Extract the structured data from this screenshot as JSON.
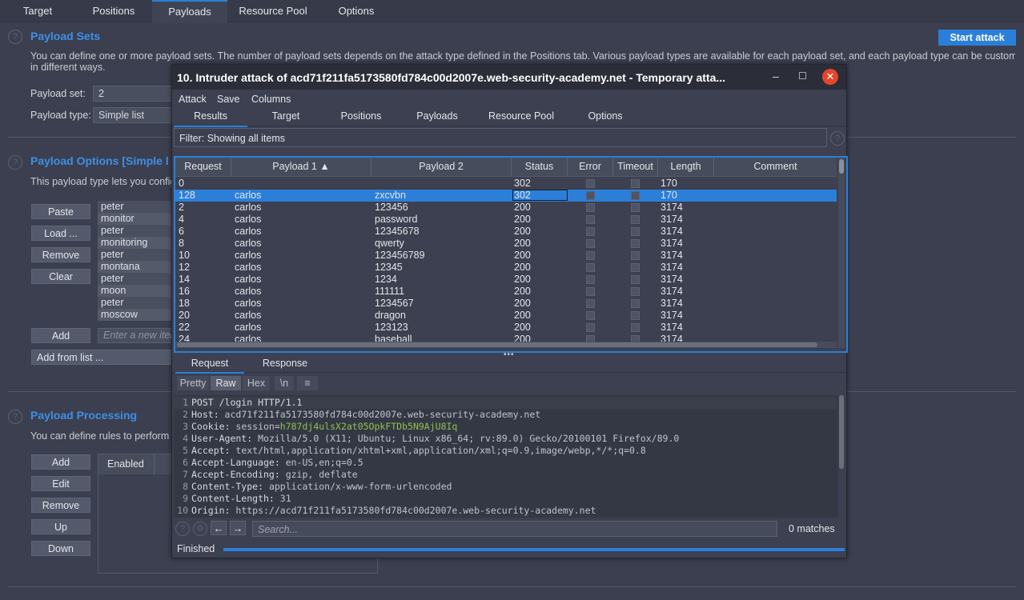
{
  "top_tabs": [
    "Target",
    "Positions",
    "Payloads",
    "Resource Pool",
    "Options"
  ],
  "active_top_tab": "Payloads",
  "start_attack_label": "Start attack",
  "payload_sets": {
    "title": "Payload Sets",
    "description_line1": "You can define one or more payload sets. The number of payload sets depends on the attack type defined in the Positions tab. Various payload types are available for each payload set, and each payload type can be customized",
    "description_line2": "in different ways.",
    "set_label": "Payload set:",
    "set_value": "2",
    "type_label": "Payload type:",
    "type_value": "Simple list"
  },
  "payload_options": {
    "title": "Payload Options [Simple l",
    "description": "This payload type lets you config",
    "buttons": [
      "Paste",
      "Load ...",
      "Remove",
      "Clear"
    ],
    "list_items": [
      "peter",
      "monitor",
      "peter",
      "monitoring",
      "peter",
      "montana",
      "peter",
      "moon",
      "peter",
      "moscow"
    ],
    "add_label": "Add",
    "add_placeholder": "Enter a new iter",
    "add_from_list_label": "Add from list ..."
  },
  "payload_processing": {
    "title": "Payload Processing",
    "description": "You can define rules to perform w",
    "buttons": [
      "Add",
      "Edit",
      "Remove",
      "Up",
      "Down"
    ],
    "table_header": "Enabled"
  },
  "dialog": {
    "title": "10. Intruder attack of acd71f211fa5173580fd784c00d2007e.web-security-academy.net - Temporary atta...",
    "minimize": "–",
    "maximize": "☐",
    "close": "✕",
    "menu": [
      "Attack",
      "Save",
      "Columns"
    ],
    "tabs": [
      "Results",
      "Target",
      "Positions",
      "Payloads",
      "Resource Pool",
      "Options"
    ],
    "active_tab": "Results",
    "filter_text": "Filter: Showing all items",
    "columns": [
      "Request",
      "Payload 1 ▲",
      "Payload 2",
      "Status",
      "Error",
      "Timeout",
      "Length",
      "Comment"
    ],
    "rows": [
      {
        "request": "0",
        "p1": "",
        "p2": "",
        "status": "302",
        "length": "170"
      },
      {
        "request": "128",
        "p1": "carlos",
        "p2": "zxcvbn",
        "status": "302",
        "length": "170"
      },
      {
        "request": "2",
        "p1": "carlos",
        "p2": "123456",
        "status": "200",
        "length": "3174"
      },
      {
        "request": "4",
        "p1": "carlos",
        "p2": "password",
        "status": "200",
        "length": "3174"
      },
      {
        "request": "6",
        "p1": "carlos",
        "p2": "12345678",
        "status": "200",
        "length": "3174"
      },
      {
        "request": "8",
        "p1": "carlos",
        "p2": "qwerty",
        "status": "200",
        "length": "3174"
      },
      {
        "request": "10",
        "p1": "carlos",
        "p2": "123456789",
        "status": "200",
        "length": "3174"
      },
      {
        "request": "12",
        "p1": "carlos",
        "p2": "12345",
        "status": "200",
        "length": "3174"
      },
      {
        "request": "14",
        "p1": "carlos",
        "p2": "1234",
        "status": "200",
        "length": "3174"
      },
      {
        "request": "16",
        "p1": "carlos",
        "p2": "111111",
        "status": "200",
        "length": "3174"
      },
      {
        "request": "18",
        "p1": "carlos",
        "p2": "1234567",
        "status": "200",
        "length": "3174"
      },
      {
        "request": "20",
        "p1": "carlos",
        "p2": "dragon",
        "status": "200",
        "length": "3174"
      },
      {
        "request": "22",
        "p1": "carlos",
        "p2": "123123",
        "status": "200",
        "length": "3174"
      },
      {
        "request": "24",
        "p1": "carlos",
        "p2": "baseball",
        "status": "200",
        "length": "3174"
      }
    ],
    "selected_row_index": 1,
    "req_resp_tabs": [
      "Request",
      "Response"
    ],
    "active_req_resp_tab": "Request",
    "format_buttons": [
      "Pretty",
      "Raw",
      "Hex",
      "\\n",
      "≡"
    ],
    "active_format": "Raw",
    "request_lines": [
      {
        "n": "1",
        "name": "POST /login HTTP/1.1",
        "value": ""
      },
      {
        "n": "2",
        "name": "Host:",
        "value": " acd71f211fa5173580fd784c00d2007e.web-security-academy.net"
      },
      {
        "n": "3",
        "name": "Cookie:",
        "value": " session=",
        "extra": "h787dj4ulsX2at05OpkFTDb5N9AjU8Iq"
      },
      {
        "n": "4",
        "name": "User-Agent:",
        "value": " Mozilla/5.0 (X11; Ubuntu; Linux x86_64; rv:89.0) Gecko/20100101 Firefox/89.0"
      },
      {
        "n": "5",
        "name": "Accept:",
        "value": " text/html,application/xhtml+xml,application/xml;q=0.9,image/webp,*/*;q=0.8"
      },
      {
        "n": "6",
        "name": "Accept-Language:",
        "value": " en-US,en;q=0.5"
      },
      {
        "n": "7",
        "name": "Accept-Encoding:",
        "value": " gzip, deflate"
      },
      {
        "n": "8",
        "name": "Content-Type:",
        "value": " application/x-www-form-urlencoded"
      },
      {
        "n": "9",
        "name": "Content-Length:",
        "value": " 31"
      },
      {
        "n": "10",
        "name": "Origin:",
        "value": " https://acd71f211fa5173580fd784c00d2007e.web-security-academy.net"
      }
    ],
    "search_placeholder": "Search...",
    "matches_text": "0 matches",
    "status_text": "Finished",
    "progress_fraction": 1.0
  },
  "colors": {
    "accent": "#2b7fd8",
    "title_blue": "#3f8fe6",
    "close_red": "#e5452c",
    "session_green": "#8cc34a"
  }
}
